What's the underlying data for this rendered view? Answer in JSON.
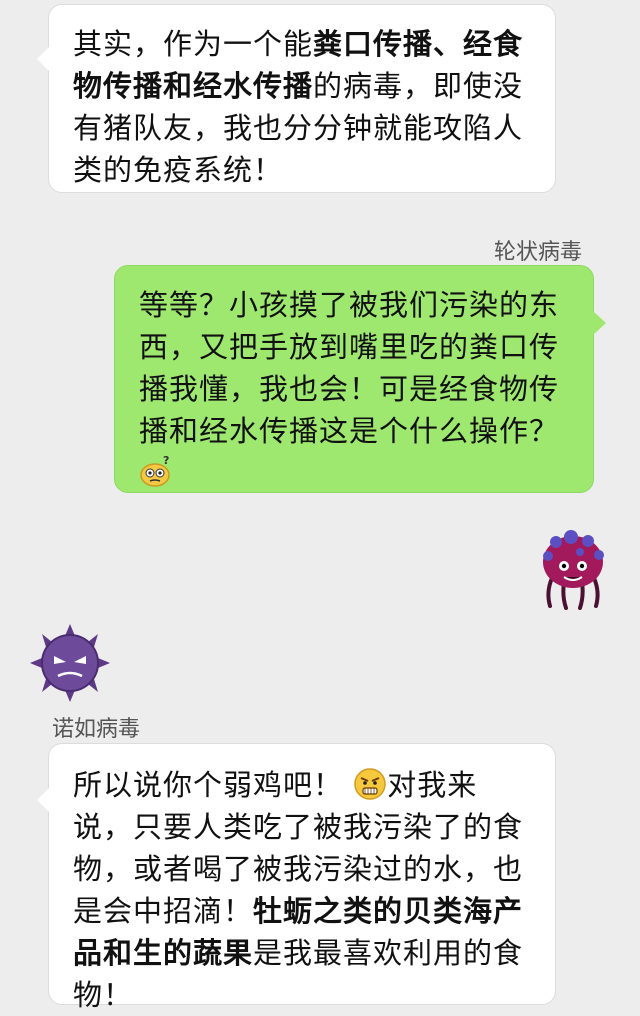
{
  "messages": [
    {
      "sender": "norovirus",
      "seg1": "其实，作为一个能",
      "seg2": "粪口传播、经食物传播和经水传播",
      "seg3": "的病毒，即使没有猪队友，我也分分钟就能攻陷人类的免疫系统！"
    },
    {
      "sender": "rotavirus",
      "sender_name": "轮状病毒",
      "seg1": "等等？小孩摸了被我们污染的东西，又把手放到嘴里吃的粪口传播我懂，我也会！可是经食物传播和经水传播这是个什么操作？",
      "emoji": "confused-face-icon"
    },
    {
      "sender": "norovirus",
      "sender_name": "诺如病毒",
      "seg1": "所以说你个弱鸡吧！",
      "emoji": "angry-face-icon",
      "seg2": "对我来说，只要人类吃了被我污染了的食物，或者喝了被我污染过的水，也是会中招滴！",
      "seg3": "牡蛎之类的贝类海产品和生的蔬果",
      "seg4": "是我最喜欢利用的食物！"
    }
  ],
  "colors": {
    "background": "#ededed",
    "incoming_bubble": "#ffffff",
    "outgoing_bubble": "#9ee870"
  }
}
